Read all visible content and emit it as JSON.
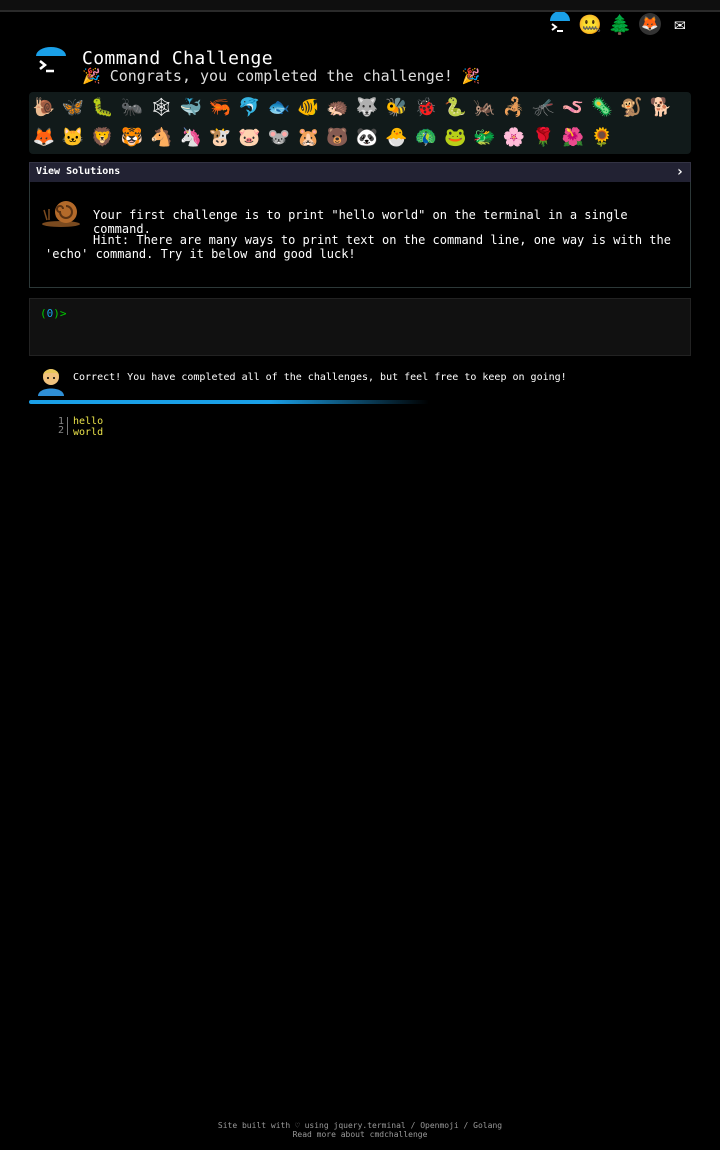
{
  "topbar": {
    "links": [
      {
        "name": "home-link",
        "icon": "terminal-logo-icon"
      },
      {
        "name": "openmoji-link",
        "icon": "🤐"
      },
      {
        "name": "tree-link",
        "icon": "🌲"
      },
      {
        "name": "gitlab-link",
        "icon": "🦊"
      },
      {
        "name": "email-link",
        "icon": "✉"
      }
    ]
  },
  "header": {
    "title": "Command Challenge",
    "subtitle": "🎉 Congrats, you completed the challenge! 🎉"
  },
  "emojis": {
    "row1": [
      "🐌",
      "🦋",
      "🐛",
      "🐜",
      "🕸",
      "🐳",
      "🦐",
      "🐬",
      "🐟",
      "🐠",
      "🦔",
      "🐺",
      "🐝",
      "🐞",
      "🐍",
      "🦗",
      "🦂",
      "🦟",
      "🪱",
      "🦠",
      "🐒",
      "🐕"
    ],
    "row2": [
      "🦊",
      "🐱",
      "🦁",
      "🐯",
      "🐴",
      "🦄",
      "🐮",
      "🐷",
      "🐭",
      "🐹",
      "🐻",
      "🐼",
      "🐣",
      "🦚",
      "🐸",
      "🐲",
      "🌸",
      "🌹",
      "🌺",
      "🌻"
    ]
  },
  "view_solutions": {
    "label": "View Solutions",
    "chevron": "›"
  },
  "challenge": {
    "text": "Your first challenge is to print \"hello world\" on the terminal in a single command.",
    "hint_line1": "Hint: There are many ways to print text on the command line, one way is with the",
    "hint_line2": "'echo' command. Try it below and good luck!"
  },
  "terminal": {
    "prompt_open": "(",
    "prompt_mid": "0",
    "prompt_close": ")>"
  },
  "result": {
    "message": "Correct! You have completed all of the challenges, but feel free to keep on going!"
  },
  "progress": {
    "percent": 100
  },
  "code": {
    "line1": "1",
    "line2": "2",
    "text": "hello world"
  },
  "footer": {
    "line1": "Site built with ♡ using jquery.terminal / Openmoji / Golang",
    "line2": "Read more about cmdchallenge"
  },
  "colors": {
    "accent": "#1aa0e8",
    "prompt": "#00cc00",
    "code": "#e8e04a"
  }
}
